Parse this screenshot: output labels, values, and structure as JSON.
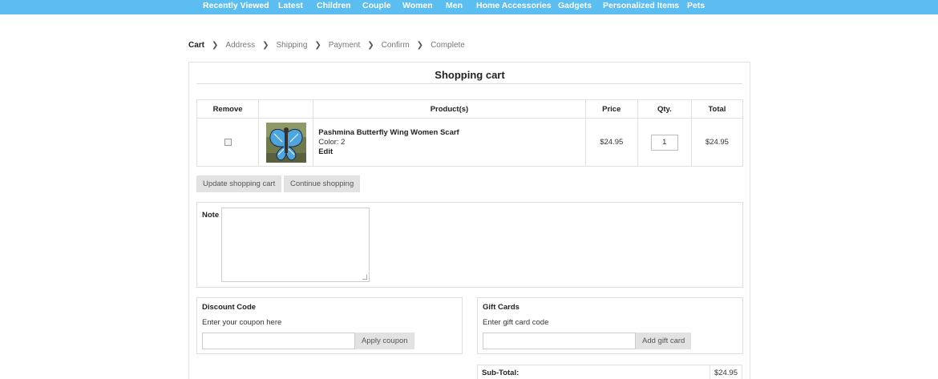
{
  "nav": {
    "items": [
      "Recently Viewed",
      "Latest",
      "Children",
      "Couple",
      "Women",
      "Men",
      "Home Accessories",
      "Gadgets",
      "Personalized Items",
      "Pets"
    ],
    "background": "#5bbdf0"
  },
  "steps": {
    "items": [
      "Cart",
      "Address",
      "Shipping",
      "Payment",
      "Confirm",
      "Complete"
    ],
    "active": "Cart",
    "separator_icon": "chevron-right-icon"
  },
  "cart": {
    "title": "Shopping cart",
    "columns": {
      "remove": "Remove",
      "image": "",
      "product": "Product(s)",
      "price": "Price",
      "qty": "Qty.",
      "total": "Total"
    },
    "items": [
      {
        "remove_checked": false,
        "image_icon": "butterfly-scarf-thumbnail",
        "name": "Pashmina Butterfly Wing Women Scarf",
        "attributes": "Color: 2",
        "edit_label": "Edit",
        "price": "$24.95",
        "qty": "1",
        "total": "$24.95"
      }
    ],
    "update_label": "Update shopping cart",
    "continue_label": "Continue shopping"
  },
  "note": {
    "label": "Note",
    "value": ""
  },
  "discount": {
    "title": "Discount Code",
    "hint": "Enter your coupon here",
    "value": "",
    "button": "Apply coupon"
  },
  "gift": {
    "title": "Gift Cards",
    "hint": "Enter gift card code",
    "value": "",
    "button": "Add gift card"
  },
  "totals": {
    "subtotal_label": "Sub-Total:",
    "subtotal_value": "$24.95"
  }
}
